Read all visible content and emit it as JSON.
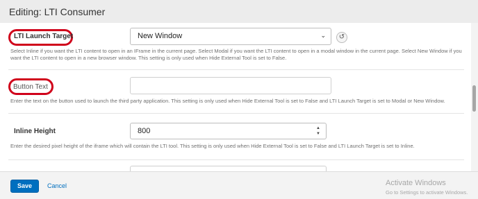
{
  "dialog": {
    "title": "Editing: LTI Consumer"
  },
  "fields": {
    "launch_target": {
      "label": "LTI Launch Target",
      "value": "New Window",
      "help": "Select Inline if you want the LTI content to open in an IFrame in the current page. Select Modal if you want the LTI content to open in a modal window in the current page. Select New Window if you want the LTI content to open in a new browser window. This setting is only used when Hide External Tool is set to False."
    },
    "button_text": {
      "label": "Button Text",
      "value": "",
      "help": "Enter the text on the button used to launch the third party application. This setting is only used when Hide External Tool is set to False and LTI Launch Target is set to Modal or New Window."
    },
    "inline_height": {
      "label": "Inline Height",
      "value": "800",
      "help": "Enter the desired pixel height of the iframe which will contain the LTI tool. This setting is only used when Hide External Tool is set to False and LTI Launch Target is set to Inline."
    }
  },
  "footer": {
    "save_label": "Save",
    "cancel_label": "Cancel"
  },
  "watermark": {
    "line1": "Activate Windows",
    "line2": "Go to Settings to activate Windows."
  },
  "colors": {
    "highlight": "#d0021b",
    "primary": "#006fbf"
  }
}
